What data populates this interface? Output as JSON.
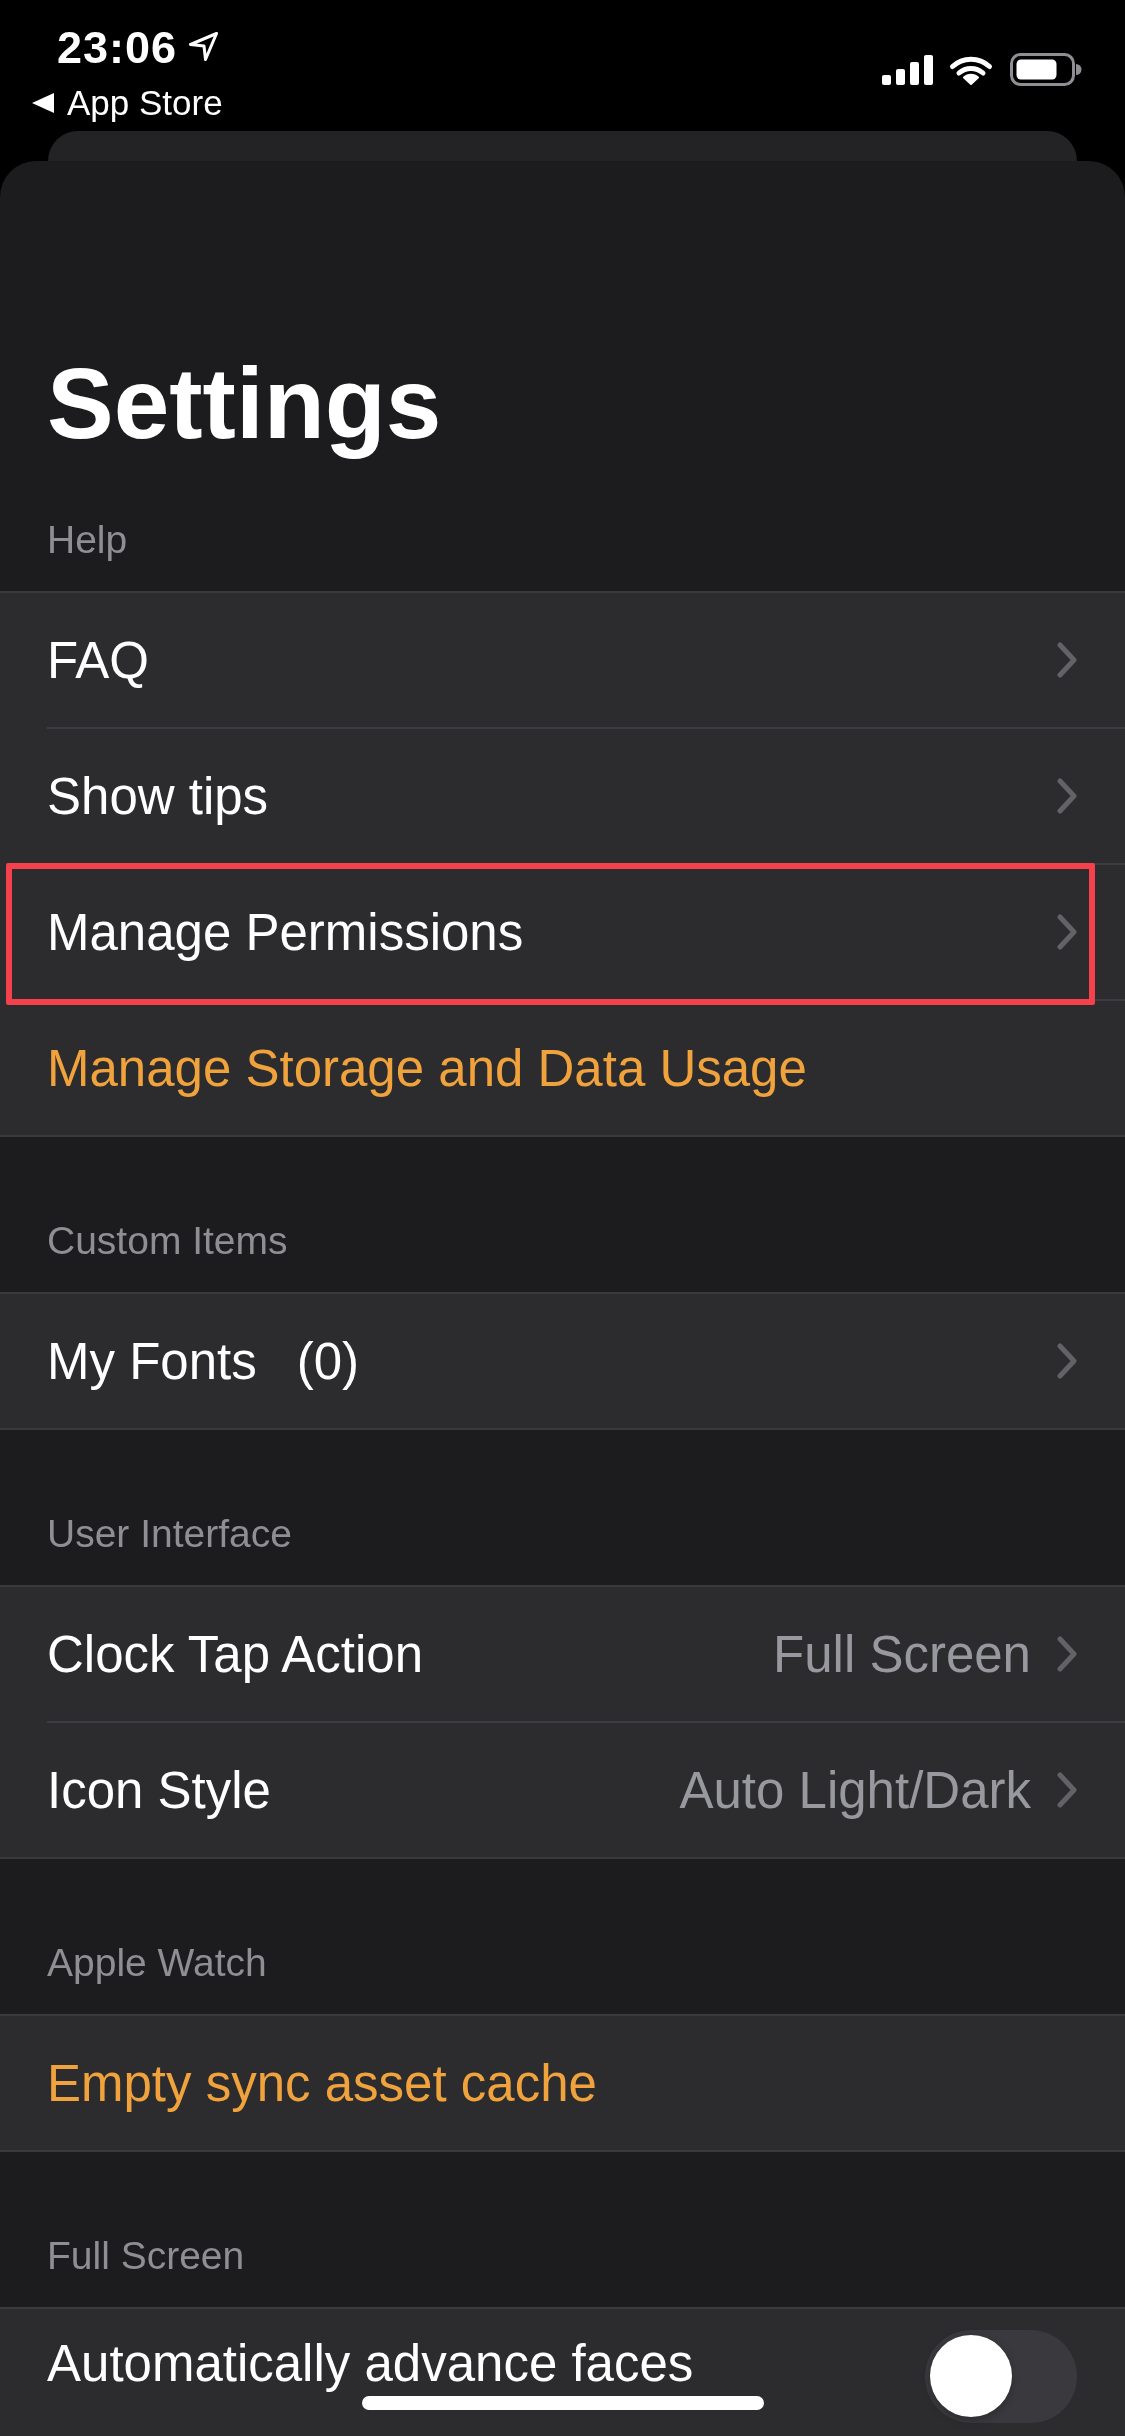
{
  "status_bar": {
    "time": "23:06",
    "back_link": "App Store"
  },
  "title": "Settings",
  "sections": [
    {
      "header": "Help",
      "rows": [
        {
          "kind": "link",
          "label": "FAQ",
          "highlighted": false
        },
        {
          "kind": "link",
          "label": "Show tips",
          "highlighted": false
        },
        {
          "kind": "link",
          "label": "Manage Permissions",
          "highlighted": true
        },
        {
          "kind": "action",
          "label": "Manage Storage and Data Usage",
          "highlighted": false
        }
      ]
    },
    {
      "header": "Custom Items",
      "rows": [
        {
          "kind": "link",
          "label": "My Fonts",
          "count": "(0)",
          "highlighted": false
        }
      ]
    },
    {
      "header": "User Interface",
      "rows": [
        {
          "kind": "value",
          "label": "Clock Tap Action",
          "value": "Full Screen",
          "highlighted": false
        },
        {
          "kind": "value",
          "label": "Icon Style",
          "value": "Auto Light/Dark",
          "highlighted": false
        }
      ]
    },
    {
      "header": "Apple Watch",
      "rows": [
        {
          "kind": "action",
          "label": "Empty sync asset cache",
          "highlighted": false
        }
      ]
    },
    {
      "header": "Full Screen",
      "rows": [
        {
          "kind": "toggle",
          "label": "Automatically advance faces",
          "on": false,
          "highlighted": false
        }
      ]
    }
  ]
}
